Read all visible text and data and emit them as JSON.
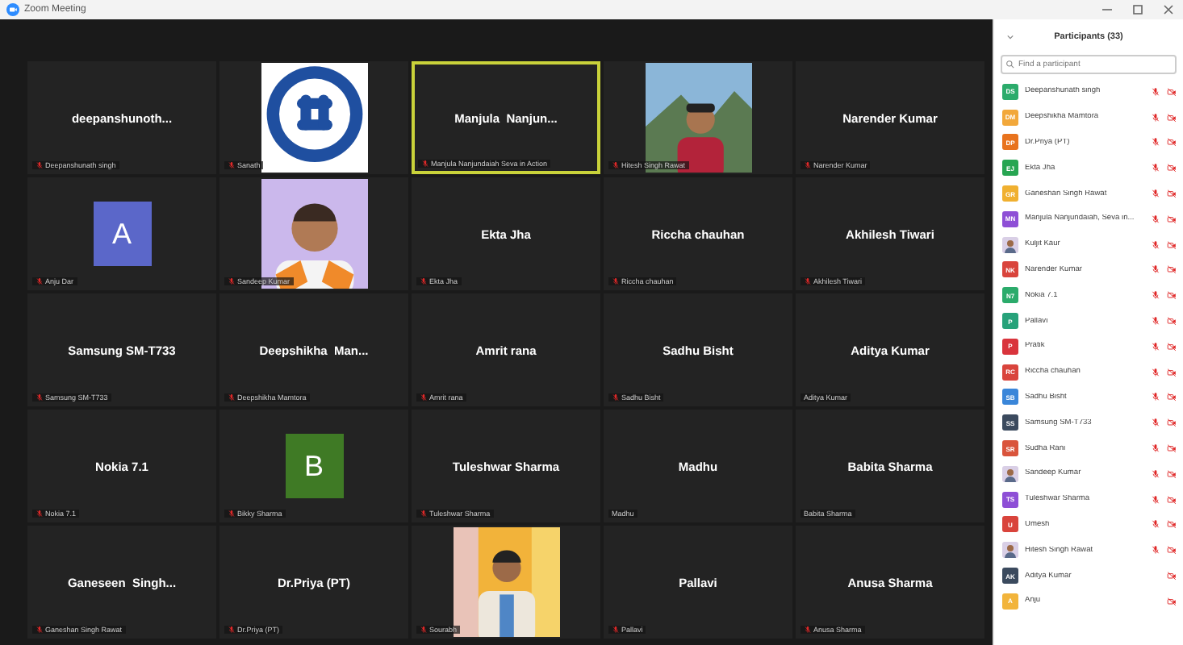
{
  "window": {
    "title": "Zoom Meeting"
  },
  "tiles": [
    {
      "kind": "name",
      "name": "deepanshunoth...",
      "label": "Deepanshunath singh",
      "muted": true,
      "speaking": false
    },
    {
      "kind": "picture",
      "label": "Sanath",
      "muted": true,
      "speaking": false
    },
    {
      "kind": "name",
      "name": "Manjula  Nanjun...",
      "label": "Manjula Nanjundaiah Seva in Action",
      "muted": true,
      "speaking": true
    },
    {
      "kind": "picture",
      "label": "Hitesh Singh Rawat",
      "muted": true,
      "speaking": false
    },
    {
      "kind": "name",
      "name": "Narender Kumar",
      "label": "Narender Kumar",
      "muted": true,
      "speaking": false
    },
    {
      "kind": "avatar",
      "initial": "A",
      "color": "#5b67c9",
      "label": "Anju Dar",
      "muted": true,
      "speaking": false
    },
    {
      "kind": "picture",
      "label": "Sandeep Kumar",
      "muted": true,
      "speaking": false
    },
    {
      "kind": "name",
      "name": "Ekta Jha",
      "label": "Ekta Jha",
      "muted": true,
      "speaking": false
    },
    {
      "kind": "name",
      "name": "Riccha chauhan",
      "label": "Riccha chauhan",
      "muted": true,
      "speaking": false
    },
    {
      "kind": "name",
      "name": "Akhilesh Tiwari",
      "label": "Akhilesh Tiwari",
      "muted": true,
      "speaking": false
    },
    {
      "kind": "name",
      "name": "Samsung SM-T733",
      "label": "Samsung SM-T733",
      "muted": true,
      "speaking": false
    },
    {
      "kind": "name",
      "name": "Deepshikha  Man...",
      "label": "Deepshikha Mamtora",
      "muted": true,
      "speaking": false
    },
    {
      "kind": "name",
      "name": "Amrit rana",
      "label": "Amrit rana",
      "muted": true,
      "speaking": false
    },
    {
      "kind": "name",
      "name": "Sadhu Bisht",
      "label": "Sadhu Bisht",
      "muted": true,
      "speaking": false
    },
    {
      "kind": "name",
      "name": "Aditya Kumar",
      "label": "Aditya Kumar",
      "muted": false,
      "speaking": false
    },
    {
      "kind": "name",
      "name": "Nokia 7.1",
      "label": "Nokia 7.1",
      "muted": true,
      "speaking": false
    },
    {
      "kind": "avatar",
      "initial": "B",
      "color": "#3f7a25",
      "label": "Bikky Sharma",
      "muted": true,
      "speaking": false
    },
    {
      "kind": "name",
      "name": "Tuleshwar Sharma",
      "label": "Tuleshwar Sharma",
      "muted": true,
      "speaking": false
    },
    {
      "kind": "name",
      "name": "Madhu",
      "label": "Madhu",
      "muted": false,
      "speaking": false
    },
    {
      "kind": "name",
      "name": "Babita Sharma",
      "label": "Babita Sharma",
      "muted": false,
      "speaking": false
    },
    {
      "kind": "name",
      "name": "Ganeseen  Singh...",
      "label": "Ganeshan Singh Rawat",
      "muted": true,
      "speaking": false
    },
    {
      "kind": "name",
      "name": "Dr.Priya (PT)",
      "label": "Dr.Priya (PT)",
      "muted": true,
      "speaking": false
    },
    {
      "kind": "picture",
      "label": "Sourabh",
      "muted": true,
      "speaking": false
    },
    {
      "kind": "name",
      "name": "Pallavi",
      "label": "Pallavi",
      "muted": true,
      "speaking": false
    },
    {
      "kind": "name",
      "name": "Anusa Sharma",
      "label": "Anusa Sharma",
      "muted": true,
      "speaking": false
    }
  ],
  "participants_panel": {
    "title": "Participants (33)",
    "search": {
      "placeholder": "Find a participant"
    },
    "participants": [
      {
        "kind": "initials",
        "initials": "DS",
        "color": "#2bab6b",
        "name": "Deepanshunath singh",
        "muted": true
      },
      {
        "kind": "initials",
        "initials": "DM",
        "color": "#f2a83b",
        "name": "Deepshikha Mamtora",
        "muted": true
      },
      {
        "kind": "initials",
        "initials": "DP",
        "color": "#e8731e",
        "name": "Dr.Priya (PT)",
        "muted": true
      },
      {
        "kind": "initials",
        "initials": "EJ",
        "color": "#27a552",
        "name": "Ekta Jha",
        "muted": true
      },
      {
        "kind": "initials",
        "initials": "GR",
        "color": "#f0b030",
        "name": "Ganeshan Singh Rawat",
        "muted": true
      },
      {
        "kind": "initials",
        "initials": "MN",
        "color": "#8e4fd6",
        "name": "Manjula Nanjundaiah, Seva in...",
        "muted": true
      },
      {
        "name": "Kuljit Kaur",
        "muted": true
      },
      {
        "kind": "initials",
        "initials": "NK",
        "color": "#d9443c",
        "name": "Narender Kumar",
        "muted": true
      },
      {
        "kind": "initials",
        "initials": "N7",
        "color": "#2bab6b",
        "name": "Nokia 7.1",
        "muted": true
      },
      {
        "kind": "initials",
        "initials": "P",
        "color": "#27a27a",
        "name": "Pallavi",
        "muted": true
      },
      {
        "kind": "initials",
        "initials": "P",
        "color": "#d9343c",
        "name": "Pratik",
        "muted": true
      },
      {
        "kind": "initials",
        "initials": "RC",
        "color": "#d9443c",
        "name": "Riccha chauhan",
        "muted": true
      },
      {
        "kind": "initials",
        "initials": "SB",
        "color": "#3a86d9",
        "name": "Sadhu Bisht",
        "muted": true
      },
      {
        "kind": "initials",
        "initials": "SS",
        "color": "#3b4a5e",
        "name": "Samsung SM-T733",
        "muted": true
      },
      {
        "kind": "initials",
        "initials": "SR",
        "color": "#d9543c",
        "name": "Sudha Rani",
        "muted": true
      },
      {
        "name": "Sandeep Kumar",
        "muted": true
      },
      {
        "kind": "initials",
        "initials": "TS",
        "color": "#8e4fd6",
        "name": "Tuleshwar Sharma",
        "muted": true
      },
      {
        "kind": "initials",
        "initials": "U",
        "color": "#d9443c",
        "name": "Umesh",
        "muted": true
      },
      {
        "name": "Hitesh Singh Rawat",
        "muted": true
      },
      {
        "kind": "initials",
        "initials": "AK",
        "color": "#3b4a5e",
        "name": "Aditya Kumar",
        "muted": false
      },
      {
        "kind": "initials",
        "initials": "A",
        "color": "#f2b43b",
        "name": "Anju",
        "muted": false
      }
    ]
  }
}
